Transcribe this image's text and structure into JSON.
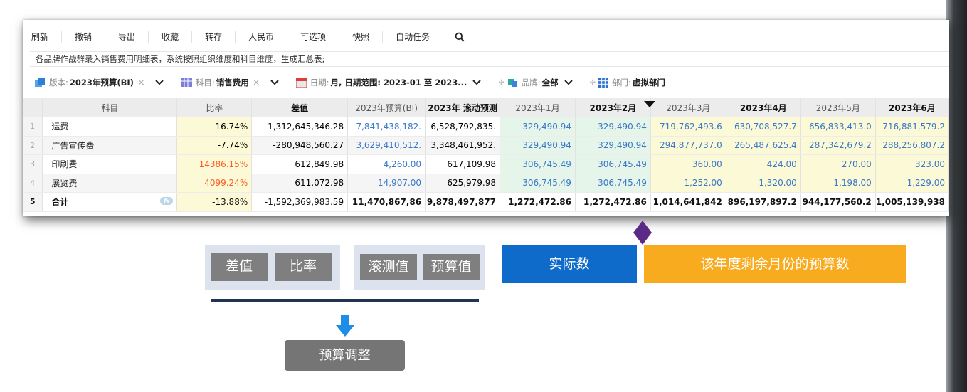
{
  "toolbar": {
    "items": [
      "刷新",
      "撤销",
      "导出",
      "收藏",
      "转存",
      "人民币",
      "可选项",
      "快照",
      "自动任务"
    ]
  },
  "description": "各品牌作战群录入销售费用明细表，系统按照组织维度和科目维度，生成汇总表;",
  "filters": {
    "version_label": "版本:",
    "version_value": "2023年预算(BI)",
    "subject_label": "科目:",
    "subject_value": "销售费用",
    "date_label": "日期:",
    "date_value": "月, 日期范围: 2023-01 至 2023...",
    "brand_label": "品牌:",
    "brand_value": "全部",
    "dept_label": "部门:",
    "dept_value": "虚拟部门"
  },
  "table": {
    "headers": [
      "科目",
      "比率",
      "差值",
      "2023年预算(BI)",
      "2023年 滚动预测",
      "2023年1月",
      "2023年2月",
      "2023年3月",
      "2023年4月",
      "2023年5月",
      "2023年6月"
    ],
    "rows": [
      {
        "n": "1",
        "cells": [
          "运费",
          "-16.74%",
          "-1,312,645,346.28",
          "7,841,438,182.",
          "6,528,792,835.",
          "329,490.94",
          "329,490.94",
          "719,762,493.6",
          "630,708,527.7",
          "656,833,413.0",
          "716,881,579.2"
        ]
      },
      {
        "n": "2",
        "cells": [
          "广告宣传费",
          "-7.74%",
          "-280,948,560.27",
          "3,629,410,512.",
          "3,348,461,952.",
          "329,490.94",
          "329,490.94",
          "294,877,737.0",
          "265,487,625.4",
          "287,342,679.2",
          "288,256,807.2"
        ]
      },
      {
        "n": "3",
        "cells": [
          "印刷费",
          "14386.15%",
          "612,849.98",
          "4,260.00",
          "617,109.98",
          "306,745.49",
          "306,745.49",
          "360.00",
          "424.00",
          "270.00",
          "323.00"
        ]
      },
      {
        "n": "4",
        "cells": [
          "展览费",
          "4099.24%",
          "611,072.98",
          "14,907.00",
          "625,979.98",
          "306,745.49",
          "306,745.49",
          "1,252.00",
          "1,320.00",
          "1,198.00",
          "1,229.00"
        ]
      },
      {
        "n": "5",
        "cells": [
          "合计",
          "-13.88%",
          "-1,592,369,983.59",
          "11,470,867,86",
          "9,878,497,877",
          "1,272,472.86",
          "1,272,472.86",
          "1,014,641,842",
          "896,197,897.2",
          "944,177,560.2",
          "1,005,139,938"
        ]
      }
    ],
    "fx_badge": "fx"
  },
  "legend": {
    "diff": "差值",
    "rate": "比率",
    "rolling": "滚测值",
    "budget": "预算值",
    "actual": "实际数",
    "remaining": "该年度剩余月份的预算数",
    "adjust": "预算调整"
  },
  "colors": {
    "actual": "#0e6bc9",
    "remaining": "#f9ab1f",
    "gray_button": "#7f7f7f",
    "legend_bg": "#dce3ee",
    "diamond": "#5b2a86"
  }
}
